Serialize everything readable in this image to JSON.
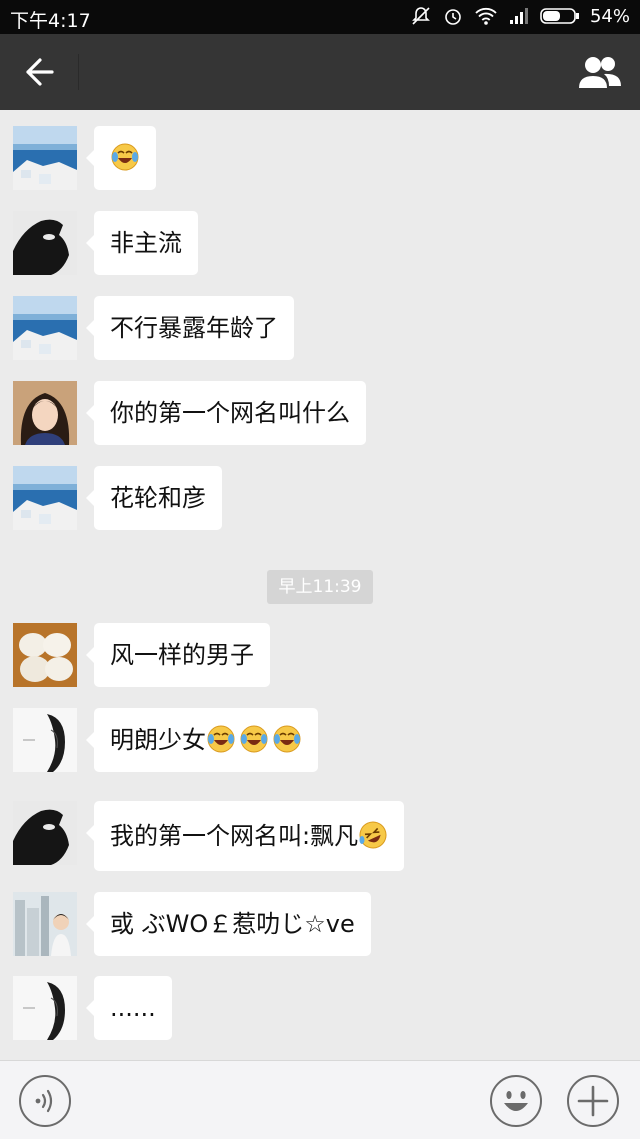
{
  "status_bar": {
    "time": "下午4:17",
    "battery": "54%"
  },
  "title_bar": {
    "back_icon": "back-arrow-icon",
    "contacts_icon": "group-contacts-icon"
  },
  "messages": [
    {
      "avatar": "sea-landscape-avatar",
      "text": "",
      "emoji_count": 1
    },
    {
      "avatar": "hand-shadow-avatar",
      "text": "非主流",
      "emoji_count": 0
    },
    {
      "avatar": "sea-landscape-avatar",
      "text": "不行暴露年龄了",
      "emoji_count": 0
    },
    {
      "avatar": "girl-portrait-avatar",
      "text": "你的第一个网名叫什么",
      "emoji_count": 0
    },
    {
      "avatar": "sea-landscape-avatar",
      "text": "花轮和彦",
      "emoji_count": 0
    },
    {
      "avatar": "dumplings-avatar",
      "text": "风一样的男子",
      "emoji_count": 0
    },
    {
      "avatar": "sketch-girl-avatar",
      "text": "明朗少女",
      "emoji_count": 3
    },
    {
      "avatar": "hand-shadow-avatar",
      "text": "我的第一个网名叫:飘凡",
      "emoji_count": 1
    },
    {
      "avatar": "city-person-avatar",
      "text": "或 ぶWO￡惹叻じ☆ve",
      "emoji_count": 0
    },
    {
      "avatar": "sketch-girl-avatar",
      "text": "......",
      "emoji_count": 0
    }
  ],
  "time_divider": "早上11:39",
  "input_bar": {
    "placeholder": "",
    "voice_icon": "voice-icon",
    "emoji_icon": "smiley-icon",
    "add_icon": "plus-icon"
  },
  "colors": {
    "title_bar": "#353535",
    "chat_background": "#ebebeb",
    "bubble": "#ffffff"
  }
}
